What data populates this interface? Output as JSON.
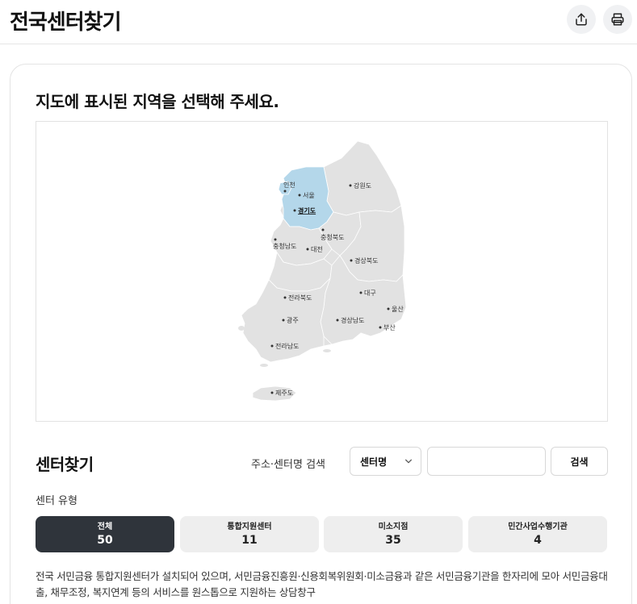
{
  "header": {
    "title": "전국센터찾기",
    "share_icon": "share-icon",
    "print_icon": "print-icon"
  },
  "map": {
    "heading": "지도에 표시된 지역을 선택해 주세요.",
    "highlight_color": "#b4d7ea",
    "land_color": "#e2e2e2",
    "selected_region": "경기도",
    "regions": [
      {
        "key": "incheon",
        "label": "인천"
      },
      {
        "key": "seoul",
        "label": "서울"
      },
      {
        "key": "gyeonggi",
        "label": "경기도"
      },
      {
        "key": "gangwon",
        "label": "강원도"
      },
      {
        "key": "chungbuk",
        "label": "충청북도"
      },
      {
        "key": "chungnam",
        "label": "충청남도"
      },
      {
        "key": "daejeon",
        "label": "대전"
      },
      {
        "key": "gyeongbuk",
        "label": "경상북도"
      },
      {
        "key": "daegu",
        "label": "대구"
      },
      {
        "key": "jeonbuk",
        "label": "전라북도"
      },
      {
        "key": "ulsan",
        "label": "울산"
      },
      {
        "key": "gwangju",
        "label": "광주"
      },
      {
        "key": "gyeongnam",
        "label": "경상남도"
      },
      {
        "key": "busan",
        "label": "부산"
      },
      {
        "key": "jeonnam",
        "label": "전라남도"
      },
      {
        "key": "jeju",
        "label": "제주도"
      }
    ]
  },
  "finder": {
    "title": "센터찾기",
    "search_label": "주소·센터명 검색",
    "select_value": "센터명",
    "input_value": "",
    "input_placeholder": "",
    "search_button": "검색",
    "type_label": "센터 유형",
    "types": [
      {
        "name": "전체",
        "count": "50",
        "active": true
      },
      {
        "name": "통합지원센터",
        "count": "11",
        "active": false
      },
      {
        "name": "미소지점",
        "count": "35",
        "active": false
      },
      {
        "name": "민간사업수행기관",
        "count": "4",
        "active": false
      }
    ],
    "description": "전국 서민금융 통합지원센터가 설치되어 있으며, 서민금융진흥원·신용회복위원회·미소금융과 같은 서민금융기관을 한자리에 모아 서민금융대출, 채무조정, 복지연계 등의 서비스를 원스톱으로 지원하는 상담창구"
  }
}
